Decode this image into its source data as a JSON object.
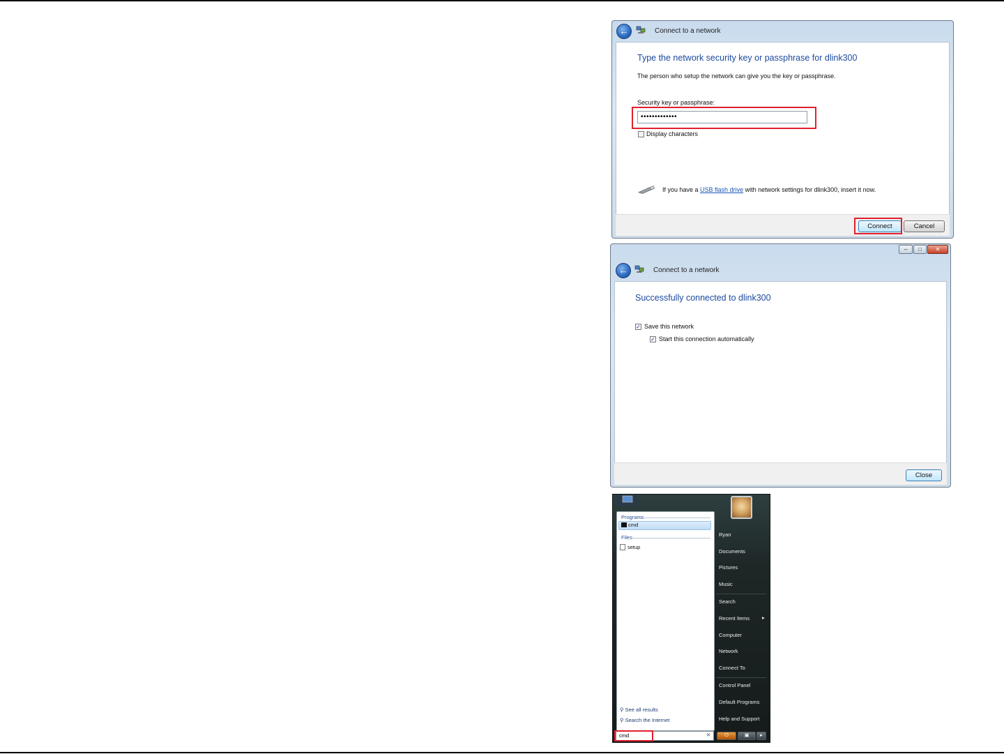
{
  "dialog1": {
    "title": "Connect to a network",
    "heading": "Type the network security key or passphrase for dlink300",
    "description": "The person who setup the network can give you the key or passphrase.",
    "key_label": "Security key or passphrase:",
    "key_value": "•••••••••••••",
    "display_characters_label": "Display characters",
    "usb_prefix": "If you have a ",
    "usb_link": "USB flash drive",
    "usb_suffix": " with network settings for dlink300, insert it now.",
    "connect_label": "Connect",
    "cancel_label": "Cancel"
  },
  "dialog2": {
    "title": "Connect to a network",
    "heading": "Successfully connected to dlink300",
    "save_network_label": "Save this network",
    "auto_start_label": "Start this connection automatically",
    "close_label": "Close",
    "save_network_checked": true,
    "auto_start_checked": true
  },
  "start_menu": {
    "programs_header": "Programs",
    "files_header": "Files",
    "program_items": [
      "cmd"
    ],
    "file_items": [
      "setup"
    ],
    "see_all_results": "See all results",
    "search_internet": "Search the Internet",
    "search_value": "cmd",
    "right_items": [
      "Ryan",
      "Documents",
      "Pictures",
      "Music",
      "Search",
      "Recent Items",
      "Computer",
      "Network",
      "Connect To",
      "Control Panel",
      "Default Programs",
      "Help and Support"
    ]
  },
  "colors": {
    "highlight_red": "#e0202c",
    "heading_blue": "#1c4a9c",
    "link_blue": "#1a54b6"
  }
}
